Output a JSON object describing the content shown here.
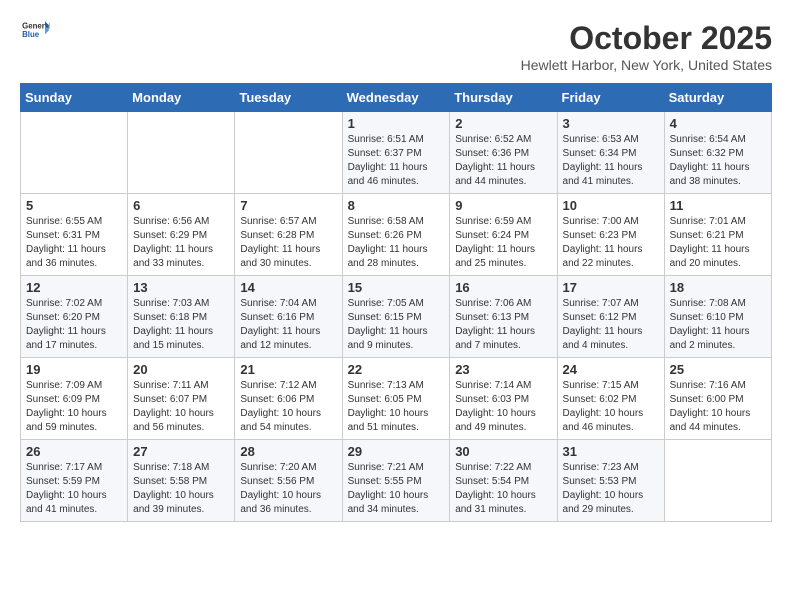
{
  "logo": {
    "general": "General",
    "blue": "Blue"
  },
  "header": {
    "title": "October 2025",
    "subtitle": "Hewlett Harbor, New York, United States"
  },
  "weekdays": [
    "Sunday",
    "Monday",
    "Tuesday",
    "Wednesday",
    "Thursday",
    "Friday",
    "Saturday"
  ],
  "weeks": [
    [
      {
        "day": "",
        "info": ""
      },
      {
        "day": "",
        "info": ""
      },
      {
        "day": "",
        "info": ""
      },
      {
        "day": "1",
        "info": "Sunrise: 6:51 AM\nSunset: 6:37 PM\nDaylight: 11 hours\nand 46 minutes."
      },
      {
        "day": "2",
        "info": "Sunrise: 6:52 AM\nSunset: 6:36 PM\nDaylight: 11 hours\nand 44 minutes."
      },
      {
        "day": "3",
        "info": "Sunrise: 6:53 AM\nSunset: 6:34 PM\nDaylight: 11 hours\nand 41 minutes."
      },
      {
        "day": "4",
        "info": "Sunrise: 6:54 AM\nSunset: 6:32 PM\nDaylight: 11 hours\nand 38 minutes."
      }
    ],
    [
      {
        "day": "5",
        "info": "Sunrise: 6:55 AM\nSunset: 6:31 PM\nDaylight: 11 hours\nand 36 minutes."
      },
      {
        "day": "6",
        "info": "Sunrise: 6:56 AM\nSunset: 6:29 PM\nDaylight: 11 hours\nand 33 minutes."
      },
      {
        "day": "7",
        "info": "Sunrise: 6:57 AM\nSunset: 6:28 PM\nDaylight: 11 hours\nand 30 minutes."
      },
      {
        "day": "8",
        "info": "Sunrise: 6:58 AM\nSunset: 6:26 PM\nDaylight: 11 hours\nand 28 minutes."
      },
      {
        "day": "9",
        "info": "Sunrise: 6:59 AM\nSunset: 6:24 PM\nDaylight: 11 hours\nand 25 minutes."
      },
      {
        "day": "10",
        "info": "Sunrise: 7:00 AM\nSunset: 6:23 PM\nDaylight: 11 hours\nand 22 minutes."
      },
      {
        "day": "11",
        "info": "Sunrise: 7:01 AM\nSunset: 6:21 PM\nDaylight: 11 hours\nand 20 minutes."
      }
    ],
    [
      {
        "day": "12",
        "info": "Sunrise: 7:02 AM\nSunset: 6:20 PM\nDaylight: 11 hours\nand 17 minutes."
      },
      {
        "day": "13",
        "info": "Sunrise: 7:03 AM\nSunset: 6:18 PM\nDaylight: 11 hours\nand 15 minutes."
      },
      {
        "day": "14",
        "info": "Sunrise: 7:04 AM\nSunset: 6:16 PM\nDaylight: 11 hours\nand 12 minutes."
      },
      {
        "day": "15",
        "info": "Sunrise: 7:05 AM\nSunset: 6:15 PM\nDaylight: 11 hours\nand 9 minutes."
      },
      {
        "day": "16",
        "info": "Sunrise: 7:06 AM\nSunset: 6:13 PM\nDaylight: 11 hours\nand 7 minutes."
      },
      {
        "day": "17",
        "info": "Sunrise: 7:07 AM\nSunset: 6:12 PM\nDaylight: 11 hours\nand 4 minutes."
      },
      {
        "day": "18",
        "info": "Sunrise: 7:08 AM\nSunset: 6:10 PM\nDaylight: 11 hours\nand 2 minutes."
      }
    ],
    [
      {
        "day": "19",
        "info": "Sunrise: 7:09 AM\nSunset: 6:09 PM\nDaylight: 10 hours\nand 59 minutes."
      },
      {
        "day": "20",
        "info": "Sunrise: 7:11 AM\nSunset: 6:07 PM\nDaylight: 10 hours\nand 56 minutes."
      },
      {
        "day": "21",
        "info": "Sunrise: 7:12 AM\nSunset: 6:06 PM\nDaylight: 10 hours\nand 54 minutes."
      },
      {
        "day": "22",
        "info": "Sunrise: 7:13 AM\nSunset: 6:05 PM\nDaylight: 10 hours\nand 51 minutes."
      },
      {
        "day": "23",
        "info": "Sunrise: 7:14 AM\nSunset: 6:03 PM\nDaylight: 10 hours\nand 49 minutes."
      },
      {
        "day": "24",
        "info": "Sunrise: 7:15 AM\nSunset: 6:02 PM\nDaylight: 10 hours\nand 46 minutes."
      },
      {
        "day": "25",
        "info": "Sunrise: 7:16 AM\nSunset: 6:00 PM\nDaylight: 10 hours\nand 44 minutes."
      }
    ],
    [
      {
        "day": "26",
        "info": "Sunrise: 7:17 AM\nSunset: 5:59 PM\nDaylight: 10 hours\nand 41 minutes."
      },
      {
        "day": "27",
        "info": "Sunrise: 7:18 AM\nSunset: 5:58 PM\nDaylight: 10 hours\nand 39 minutes."
      },
      {
        "day": "28",
        "info": "Sunrise: 7:20 AM\nSunset: 5:56 PM\nDaylight: 10 hours\nand 36 minutes."
      },
      {
        "day": "29",
        "info": "Sunrise: 7:21 AM\nSunset: 5:55 PM\nDaylight: 10 hours\nand 34 minutes."
      },
      {
        "day": "30",
        "info": "Sunrise: 7:22 AM\nSunset: 5:54 PM\nDaylight: 10 hours\nand 31 minutes."
      },
      {
        "day": "31",
        "info": "Sunrise: 7:23 AM\nSunset: 5:53 PM\nDaylight: 10 hours\nand 29 minutes."
      },
      {
        "day": "",
        "info": ""
      }
    ]
  ]
}
